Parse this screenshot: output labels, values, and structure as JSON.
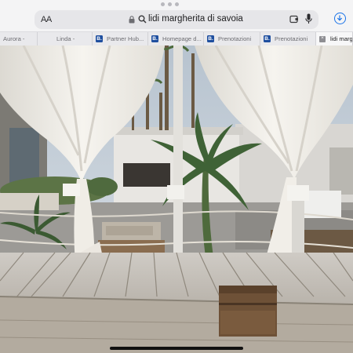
{
  "browser": {
    "reader_label": "AA",
    "url": "lidi margherita di savoia",
    "favicon_letter": "B.",
    "tabs": [
      {
        "label": "Aurora -",
        "has_favicon": false,
        "active": false
      },
      {
        "label": "Linda -",
        "has_favicon": false,
        "active": false
      },
      {
        "label": "Partner Hub...",
        "has_favicon": true,
        "active": false
      },
      {
        "label": "Homepage d...",
        "has_favicon": true,
        "active": false
      },
      {
        "label": "Prenotazioni",
        "has_favicon": true,
        "active": false
      },
      {
        "label": "Prenotazioni",
        "has_favicon": true,
        "active": false
      },
      {
        "label": "lidi margheri",
        "has_favicon": false,
        "active": true
      }
    ],
    "accent": "#1a73e8",
    "favicon_color": "#1f4f9f"
  },
  "photo": {
    "description_colors": {
      "sky": "#c9d3dc",
      "curtain": "#f1efea",
      "deck": "#bdb8b0",
      "chest": "#6e5137"
    }
  }
}
